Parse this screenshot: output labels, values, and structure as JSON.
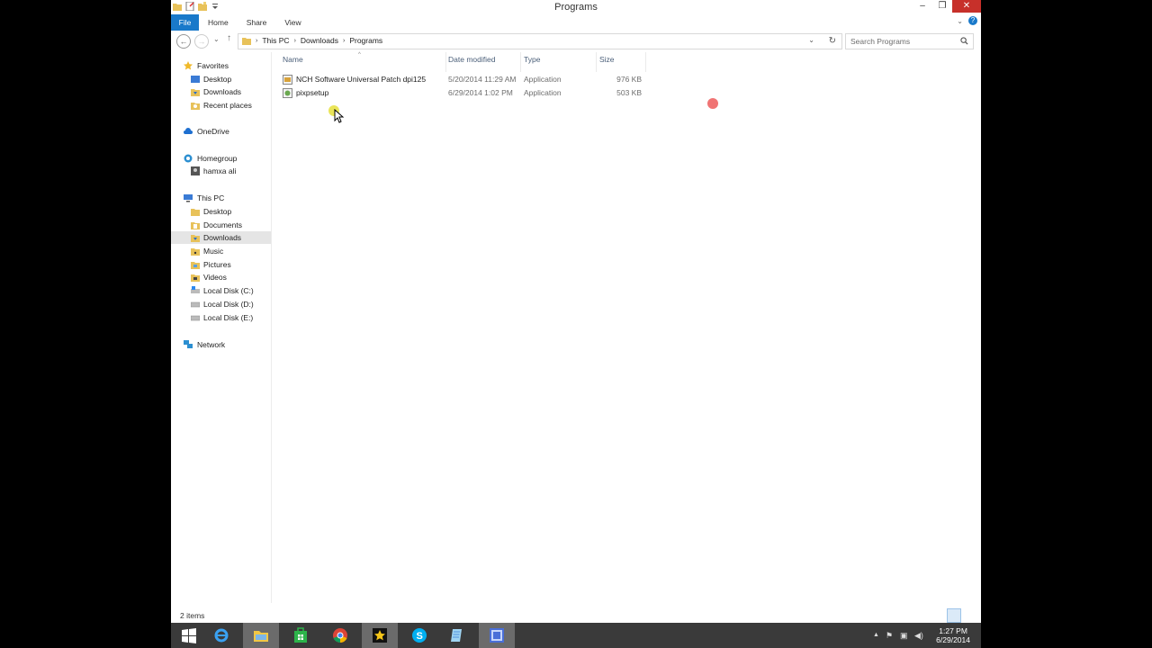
{
  "window": {
    "title": "Programs",
    "controls": {
      "minimize": "–",
      "restore": "❐",
      "close": "✕"
    }
  },
  "ribbon": {
    "tabs": [
      "File",
      "Home",
      "Share",
      "View"
    ],
    "collapse_glyph": "⌄",
    "help_glyph": "?"
  },
  "nav_buttons": {
    "back": "←",
    "forward": "→",
    "recent": "⌄",
    "up": "↑"
  },
  "address": {
    "crumbs": [
      "This PC",
      "Downloads",
      "Programs"
    ],
    "separator": "›",
    "dropdown": "⌄",
    "refresh": "↻"
  },
  "search": {
    "placeholder": "Search Programs"
  },
  "nav_pane": {
    "favorites": {
      "label": "Favorites",
      "items": [
        "Desktop",
        "Downloads",
        "Recent places"
      ]
    },
    "onedrive": {
      "label": "OneDrive"
    },
    "homegroup": {
      "label": "Homegroup",
      "items": [
        "hamxa ali"
      ]
    },
    "this_pc": {
      "label": "This PC",
      "items": [
        "Desktop",
        "Documents",
        "Downloads",
        "Music",
        "Pictures",
        "Videos",
        "Local Disk (C:)",
        "Local Disk (D:)",
        "Local Disk (E:)"
      ]
    },
    "network": {
      "label": "Network"
    }
  },
  "columns": {
    "name": "Name",
    "date": "Date modified",
    "type": "Type",
    "size": "Size",
    "sort_glyph": "^"
  },
  "files": [
    {
      "name": "NCH Software Universal Patch dpi125",
      "date": "5/20/2014 11:29 AM",
      "type": "Application",
      "size": "976 KB"
    },
    {
      "name": "pixpsetup",
      "date": "6/29/2014 1:02 PM",
      "type": "Application",
      "size": "503 KB"
    }
  ],
  "status": {
    "items_text": "2 items"
  },
  "taskbar": {
    "apps": [
      "windows-start",
      "internet-explorer",
      "file-explorer",
      "store",
      "chrome",
      "video-star",
      "skype",
      "notepad",
      "video-editor"
    ],
    "tray": {
      "up": "▲",
      "flag": "⚑",
      "network": "▣",
      "volume": "◀)"
    },
    "time": "1:27 PM",
    "date": "6/29/2014"
  },
  "colors": {
    "accent": "#1979ca",
    "close": "#c7302a",
    "taskbar": "#3a3a3a",
    "selection": "#e5e5e5",
    "header_text": "#4c607a"
  }
}
